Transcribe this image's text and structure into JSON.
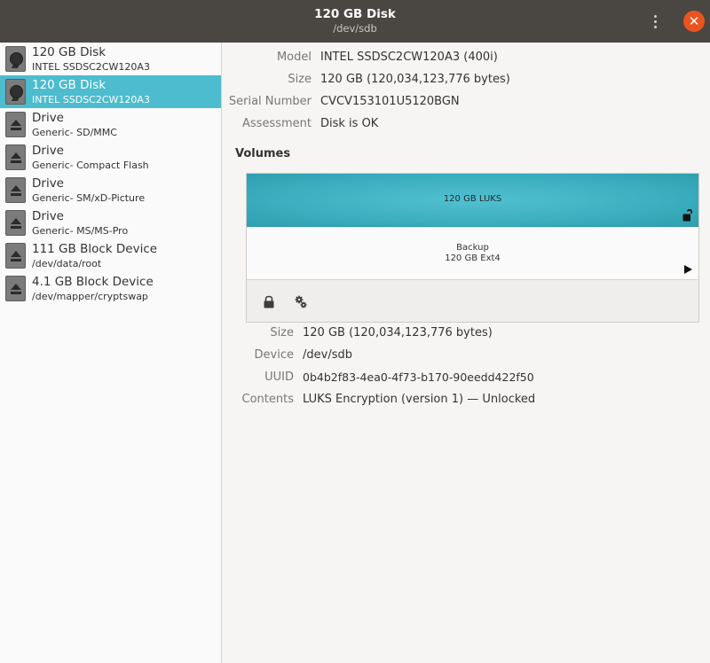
{
  "header": {
    "title": "120 GB Disk",
    "subtitle": "/dev/sdb",
    "menu_icon": "vertical-ellipsis-icon",
    "close_icon": "close-icon"
  },
  "sidebar": {
    "items": [
      {
        "name": "120 GB Disk",
        "sub": "INTEL SSDSC2CW120A3",
        "icon": "hard-disk-icon",
        "selected": false
      },
      {
        "name": "120 GB Disk",
        "sub": "INTEL SSDSC2CW120A3",
        "icon": "hard-disk-icon",
        "selected": true
      },
      {
        "name": "Drive",
        "sub": "Generic- SD/MMC",
        "icon": "eject-icon",
        "selected": false
      },
      {
        "name": "Drive",
        "sub": "Generic- Compact Flash",
        "icon": "eject-icon",
        "selected": false
      },
      {
        "name": "Drive",
        "sub": "Generic- SM/xD-Picture",
        "icon": "eject-icon",
        "selected": false
      },
      {
        "name": "Drive",
        "sub": "Generic- MS/MS-Pro",
        "icon": "eject-icon",
        "selected": false
      },
      {
        "name": "111 GB Block Device",
        "sub": "/dev/data/root",
        "icon": "eject-icon",
        "selected": false
      },
      {
        "name": "4.1 GB Block Device",
        "sub": "/dev/mapper/cryptswap",
        "icon": "eject-icon",
        "selected": false
      }
    ]
  },
  "disk_info": {
    "model_label": "Model",
    "model_value": "INTEL SSDSC2CW120A3 (400i)",
    "size_label": "Size",
    "size_value": "120 GB (120,034,123,776 bytes)",
    "serial_label": "Serial Number",
    "serial_value": "CVCV153101U5120BGN",
    "assessment_label": "Assessment",
    "assessment_value": "Disk is OK"
  },
  "volumes": {
    "heading": "Volumes",
    "luks_label": "120 GB LUKS",
    "ext4_name": "Backup",
    "ext4_size": "120 GB Ext4",
    "luks_color": "#4cbcce"
  },
  "volume_info": {
    "size_label": "Size",
    "size_value": "120 GB (120,034,123,776 bytes)",
    "device_label": "Device",
    "device_value": "/dev/sdb",
    "uuid_label": "UUID",
    "uuid_value": "0b4b2f83-4ea0-4f73-b170-90eedd422f50",
    "contents_label": "Contents",
    "contents_value": "LUKS Encryption (version 1) — Unlocked"
  },
  "colors": {
    "header_bg": "#4a4642",
    "accent": "#e95420",
    "selection": "#4cbcce"
  }
}
